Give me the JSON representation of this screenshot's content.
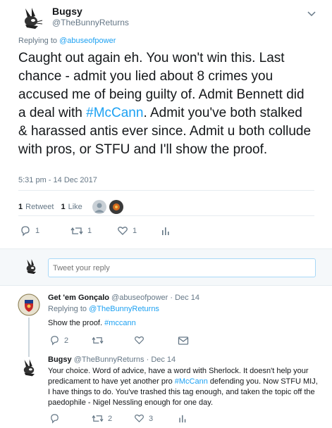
{
  "main_tweet": {
    "display_name": "Bugsy",
    "handle": "@TheBunnyReturns",
    "replying_prefix": "Replying to",
    "replying_to": "@abuseofpower",
    "text_1": "Caught out again eh. You won't win this. Last chance - admit you lied about 8 crimes you accused me of being guilty of. Admit Bennett did a deal with ",
    "hashtag": "#McCann",
    "text_2": ". Admit you've both stalked & harassed antis ever since. Admit u both collude with pros, or STFU and I'll show the proof.",
    "timestamp": "5:31 pm - 14 Dec 2017",
    "retweet_count": "1",
    "retweet_label": "Retweet",
    "like_count": "1",
    "like_label": "Like",
    "reply_action_count": "1",
    "retweet_action_count": "1",
    "like_action_count": "1"
  },
  "reply_box": {
    "placeholder": "Tweet your reply"
  },
  "replies": [
    {
      "display_name": "Get 'em Gonçalo",
      "handle": "@abuseofpower",
      "separator": "·",
      "date": "Dec 14",
      "replying_prefix": "Replying to",
      "replying_to": "@TheBunnyReturns",
      "text": "Show the proof. ",
      "hashtag": "#mccann",
      "reply_count": "2",
      "retweet_count": "",
      "like_count": ""
    },
    {
      "display_name": "Bugsy",
      "handle": "@TheBunnyReturns",
      "separator": "·",
      "date": "Dec 14",
      "text_1": "Your choice. Word of advice, have a word with Sherlock. It doesn't help your predicament to have yet another pro ",
      "hashtag": "#McCann",
      "text_2": " defending you. Now STFU MIJ, I have things to do. You've trashed this tag enough, and taken the topic off the paedophile - Nigel Nessling enough for one day.",
      "reply_count": "",
      "retweet_count": "2",
      "like_count": "3"
    }
  ],
  "colors": {
    "link": "#1da1f2",
    "secondary_text": "#657786",
    "primary_text": "#14171a",
    "divider": "#e6ecf0"
  },
  "icons": [
    "rabbit-avatar-icon",
    "chevron-down-icon",
    "reply-icon",
    "retweet-icon",
    "heart-icon",
    "analytics-icon",
    "mail-icon",
    "shield-avatar-icon"
  ]
}
